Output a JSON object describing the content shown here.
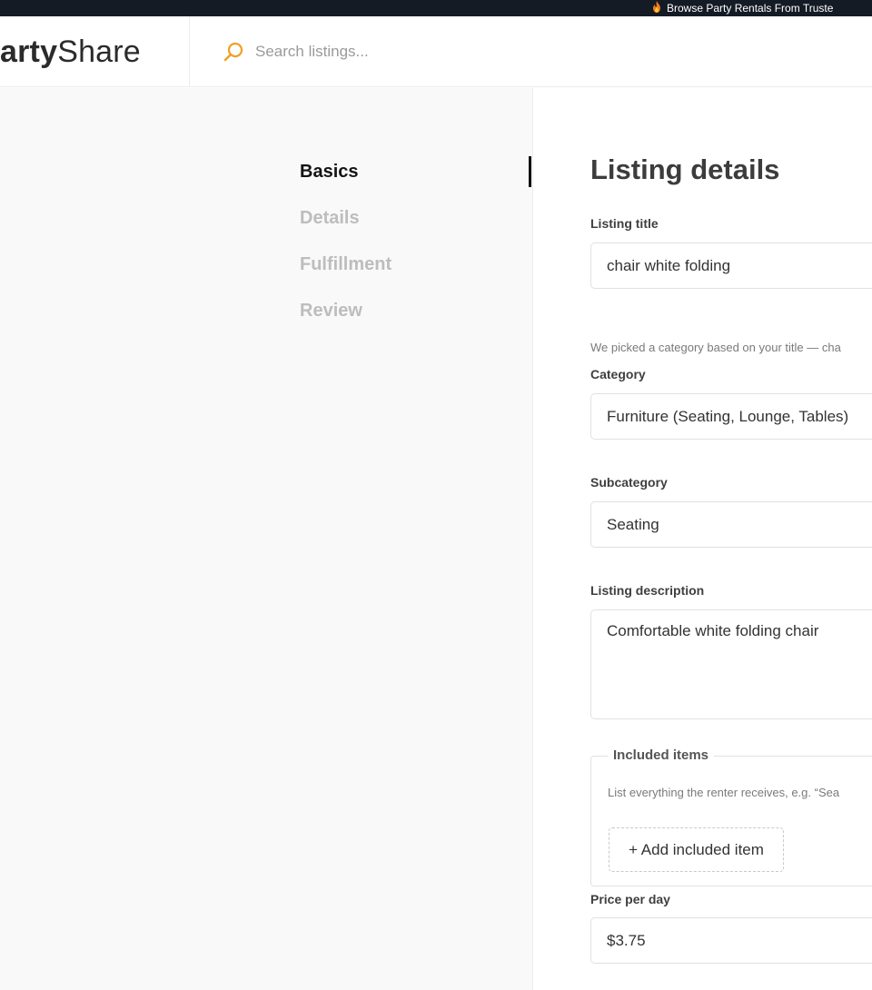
{
  "announcement": {
    "text": "Browse Party Rentals From Truste",
    "icon": "fire-icon"
  },
  "header": {
    "logo_prefix": "arty",
    "logo_suffix": "Share",
    "search": {
      "placeholder": "Search listings...",
      "value": "",
      "icon": "search-icon",
      "accent_color": "#f0a020"
    }
  },
  "steps": [
    {
      "label": "Basics",
      "active": true
    },
    {
      "label": "Details",
      "active": false
    },
    {
      "label": "Fulfillment",
      "active": false
    },
    {
      "label": "Review",
      "active": false
    }
  ],
  "form": {
    "title": "Listing details",
    "listing_title": {
      "label": "Listing title",
      "value": "chair white folding"
    },
    "category_hint": "We picked a category based on your title — cha",
    "category": {
      "label": "Category",
      "value": "Furniture (Seating, Lounge, Tables)"
    },
    "subcategory": {
      "label": "Subcategory",
      "value": "Seating"
    },
    "description": {
      "label": "Listing description",
      "value": "Comfortable white folding chair"
    },
    "included_items": {
      "legend": "Included items",
      "hint": "List everything the renter receives, e.g. “Sea",
      "add_button": "+ Add included item"
    },
    "price_per_day": {
      "label": "Price per day",
      "value": "$3.75"
    }
  }
}
